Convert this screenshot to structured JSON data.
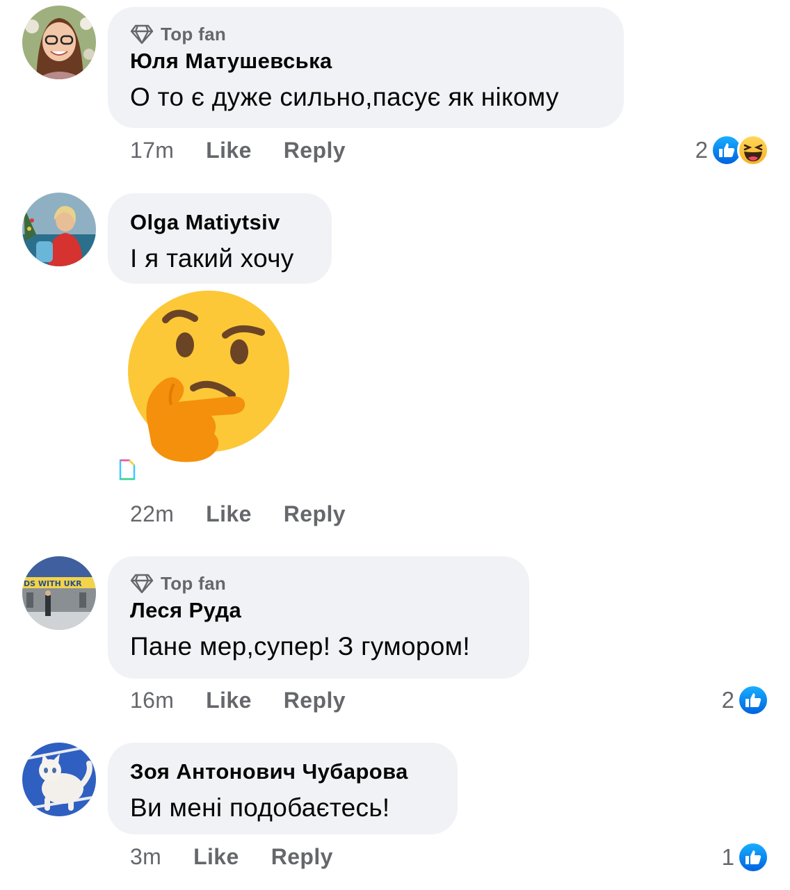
{
  "colors": {
    "bubble": "#f0f2f5",
    "meta_text": "#65676b",
    "like_blue": "#1877f2"
  },
  "comments": [
    {
      "badge_icon": "diamond-icon",
      "badge": "Top fan",
      "author": "Юля Матушевська",
      "text": "О то є дуже сильно,пасує як нікому",
      "time": "17m",
      "like": "Like",
      "reply": "Reply",
      "reaction_count": "2",
      "reactions": [
        "like-reaction-icon",
        "haha-reaction-icon"
      ]
    },
    {
      "author": "Olga Matiytsiv",
      "text": "І я такий хочу",
      "sticker": "thinking-face-emoji",
      "time": "22m",
      "like": "Like",
      "reply": "Reply"
    },
    {
      "badge_icon": "diamond-icon",
      "badge": "Top fan",
      "author": "Леся Руда",
      "text": "Пане мер,супер! З гумором!",
      "time": "16m",
      "like": "Like",
      "reply": "Reply",
      "reaction_count": "2",
      "reactions": [
        "like-reaction-icon"
      ]
    },
    {
      "author": "Зоя Антонович Чубарова",
      "text": "Ви мені подобаєтесь!",
      "time": "3m",
      "like": "Like",
      "reply": "Reply",
      "reaction_count": "1",
      "reactions": [
        "like-reaction-icon"
      ]
    }
  ]
}
